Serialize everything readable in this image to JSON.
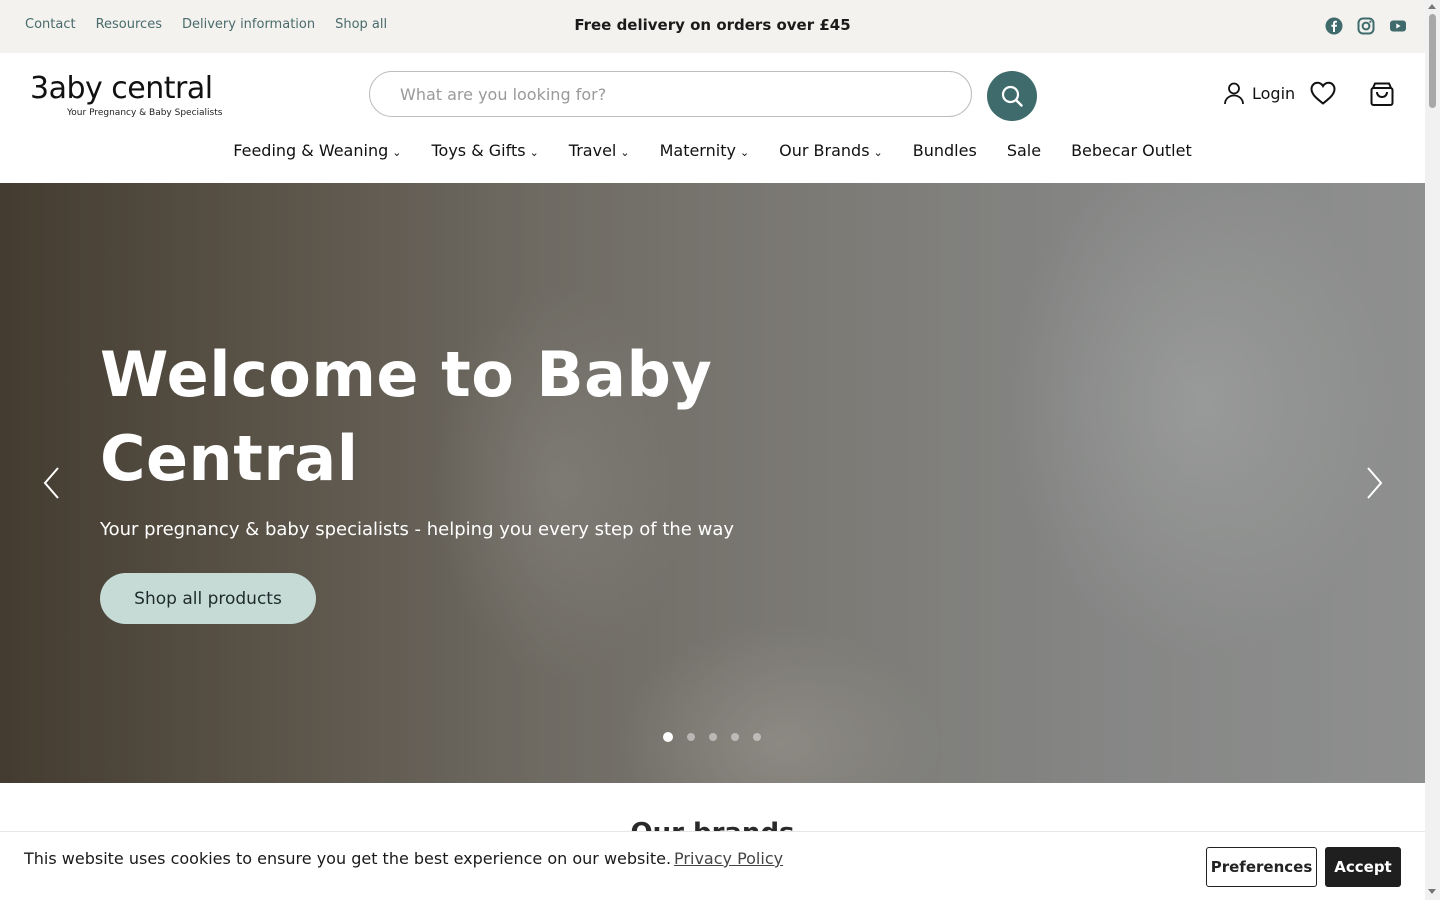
{
  "topbar": {
    "links": [
      "Contact",
      "Resources",
      "Delivery information",
      "Shop all"
    ],
    "promo": "Free delivery on orders over £45",
    "social_icons": [
      "facebook-icon",
      "instagram-icon",
      "youtube-icon"
    ]
  },
  "header": {
    "logo_text": "3aby central",
    "logo_tagline": "Your Pregnancy & Baby Specialists",
    "search_placeholder": "What are you looking for?",
    "login_label": "Login"
  },
  "nav": {
    "items": [
      {
        "label": "Feeding & Weaning",
        "chevron": "⌄"
      },
      {
        "label": "Toys & Gifts",
        "chevron": "⌄"
      },
      {
        "label": "Travel",
        "chevron": "⌄"
      },
      {
        "label": "Maternity",
        "chevron": "⌄"
      },
      {
        "label": "Our Brands",
        "chevron": "⌄"
      },
      {
        "label": "Bundles",
        "chevron": ""
      },
      {
        "label": "Sale",
        "chevron": ""
      },
      {
        "label": "Bebecar Outlet",
        "chevron": ""
      }
    ]
  },
  "hero": {
    "title": "Welcome to Baby Central",
    "subtitle": "Your pregnancy & baby specialists - helping you every step of the way",
    "cta": "Shop all products",
    "slide_count": 5,
    "active_slide": 1
  },
  "section": {
    "brands_heading": "Our brands"
  },
  "cookie": {
    "message": "This website uses cookies to ensure you get the best experience on our website.",
    "policy_link": "Privacy Policy",
    "preferences": "Preferences",
    "accept": "Accept"
  },
  "colors": {
    "accent": "#3f6b6d",
    "cta_bg": "#c6dbd6",
    "topbar_bg": "#f3f2ee"
  }
}
